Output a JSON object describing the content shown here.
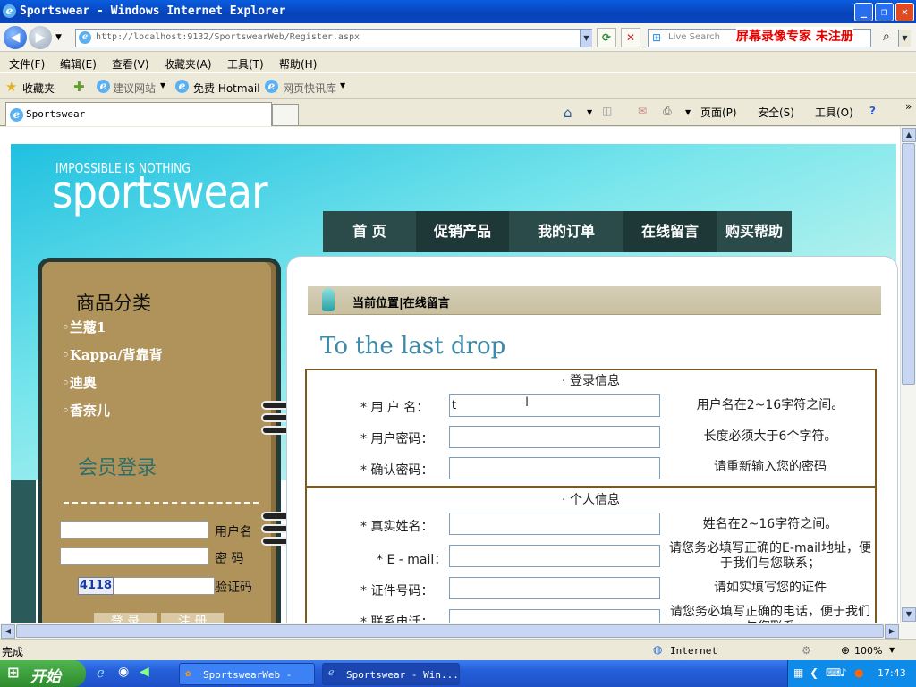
{
  "window": {
    "title": "Sportswear - Windows Internet Explorer",
    "min": "_",
    "max": "❐",
    "close": "✕"
  },
  "nav": {
    "url": "http://localhost:9132/SportswearWeb/Register.aspx",
    "search_placeholder": "Live Search",
    "watermark": "屏幕录像专家 未注册"
  },
  "menu": [
    "文件(F)",
    "编辑(E)",
    "查看(V)",
    "收藏夹(A)",
    "工具(T)",
    "帮助(H)"
  ],
  "favbar": {
    "favorites": "收藏夹",
    "suggested": "建议网站",
    "hotmail": "免费 Hotmail",
    "webslice": "网页快讯库"
  },
  "tab": {
    "label": "Sportswear"
  },
  "cmdbar": {
    "page": "页面(P)",
    "safety": "安全(S)",
    "tools": "工具(O)"
  },
  "site": {
    "slogan": "IMPOSSIBLE IS NOTHING",
    "brand": "sportswear",
    "nav": [
      "首 页",
      "促销产品",
      "我的订单",
      "在线留言",
      "购买帮助"
    ],
    "categories_title": "商品分类",
    "categories": [
      "兰蔻1",
      "Kappa/背靠背",
      "迪奥",
      "香奈儿"
    ],
    "login_title": "会员登录",
    "login_user_label": "用户名",
    "login_pwd_label": "密 码",
    "captcha_label": "验证码",
    "captcha_code": "4118",
    "login_button": "登 录",
    "register_button": "注 册",
    "breadcrumb": "当前位置|在线留言",
    "heading": "To the last drop"
  },
  "form": {
    "section1": "· 登录信息",
    "section2": "· 个人信息",
    "fields1": [
      {
        "label": "* 用 户 名：",
        "value": "t",
        "hint": "用户名在2~16字符之间。"
      },
      {
        "label": "* 用户密码：",
        "value": "",
        "hint": "长度必须大于6个字符。"
      },
      {
        "label": "* 确认密码：",
        "value": "",
        "hint": "请重新输入您的密码"
      }
    ],
    "fields2": [
      {
        "label": "* 真实姓名：",
        "value": "",
        "hint": "姓名在2~16字符之间。"
      },
      {
        "label": "* E - mail：",
        "value": "",
        "hint": "请您务必填写正确的E-mail地址，便于我们与您联系；"
      },
      {
        "label": "* 证件号码：",
        "value": "",
        "hint": "请如实填写您的证件"
      },
      {
        "label": "* 联系电话：",
        "value": "",
        "hint": "请您务必填写正确的电话，便于我们与您联系"
      }
    ]
  },
  "status": {
    "left": "完成",
    "zone": "Internet",
    "zoom": "100%"
  },
  "taskbar": {
    "start": "开始",
    "tasks": [
      "SportswearWeb - ...",
      "Sportswear - Win..."
    ],
    "clock": "17:43"
  }
}
